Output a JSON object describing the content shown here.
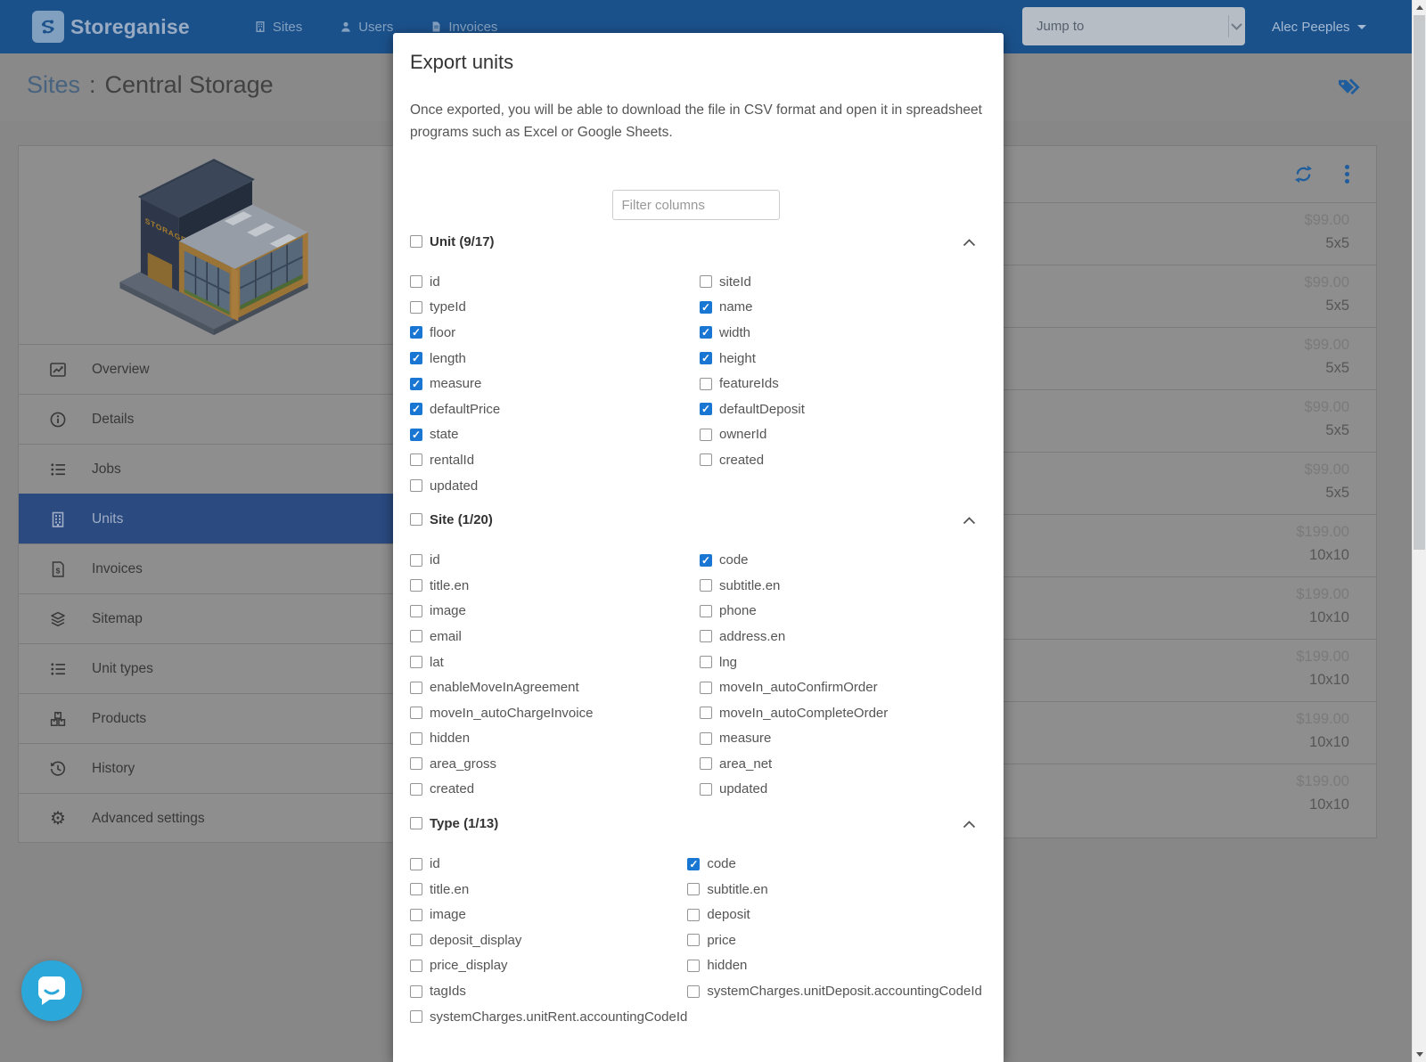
{
  "navbar": {
    "logo_text": "Storeganise",
    "items": [
      {
        "label": "Sites",
        "icon": "building-sm-icon"
      },
      {
        "label": "Users",
        "icon": "user-sm-icon"
      },
      {
        "label": "Invoices",
        "icon": "invoice-sm-icon"
      }
    ],
    "jump_to_placeholder": "Jump to",
    "user_name": "Alec Peeples"
  },
  "title_bar": {
    "breadcrumb": "Sites",
    "separator": ":",
    "title": "Central Storage"
  },
  "sidebar": {
    "items": [
      {
        "label": "Overview",
        "icon": "chart-line-icon"
      },
      {
        "label": "Details",
        "icon": "info-icon"
      },
      {
        "label": "Jobs",
        "icon": "list-icon"
      },
      {
        "label": "Units",
        "icon": "building-icon",
        "selected": true
      },
      {
        "label": "Invoices",
        "icon": "invoice-icon"
      },
      {
        "label": "Sitemap",
        "icon": "layers-icon"
      },
      {
        "label": "Unit types",
        "icon": "list-icon"
      },
      {
        "label": "Products",
        "icon": "products-icon"
      },
      {
        "label": "History",
        "icon": "history-icon"
      },
      {
        "label": "Advanced settings",
        "icon": "gear-icon"
      }
    ]
  },
  "units_table": {
    "rows": [
      {
        "price": "$99.00",
        "size": "5x5"
      },
      {
        "price": "$99.00",
        "size": "5x5"
      },
      {
        "price": "$99.00",
        "size": "5x5"
      },
      {
        "price": "$99.00",
        "size": "5x5"
      },
      {
        "price": "$99.00",
        "size": "5x5"
      },
      {
        "price": "$199.00",
        "size": "10x10"
      },
      {
        "price": "$199.00",
        "size": "10x10"
      },
      {
        "price": "$199.00",
        "size": "10x10"
      },
      {
        "price": "$199.00",
        "size": "10x10"
      },
      {
        "price": "$199.00",
        "size": "10x10"
      }
    ]
  },
  "modal": {
    "title": "Export units",
    "description": "Once exported, you will be able to download the file in CSV format and open it in spreadsheet programs such as Excel or Google Sheets.",
    "filter_placeholder": "Filter columns",
    "sections": [
      {
        "label": "Unit",
        "count": "(9/17)",
        "left": [
          {
            "label": "id",
            "checked": false
          },
          {
            "label": "typeId",
            "checked": false
          },
          {
            "label": "floor",
            "checked": true
          },
          {
            "label": "length",
            "checked": true
          },
          {
            "label": "measure",
            "checked": true
          },
          {
            "label": "defaultPrice",
            "checked": true
          },
          {
            "label": "state",
            "checked": true
          },
          {
            "label": "rentalId",
            "checked": false
          },
          {
            "label": "updated",
            "checked": false
          }
        ],
        "right": [
          {
            "label": "siteId",
            "checked": false
          },
          {
            "label": "name",
            "checked": true
          },
          {
            "label": "width",
            "checked": true
          },
          {
            "label": "height",
            "checked": true
          },
          {
            "label": "featureIds",
            "checked": false
          },
          {
            "label": "defaultDeposit",
            "checked": true
          },
          {
            "label": "ownerId",
            "checked": false
          },
          {
            "label": "created",
            "checked": false
          }
        ]
      },
      {
        "label": "Site",
        "count": "(1/20)",
        "left": [
          {
            "label": "id",
            "checked": false
          },
          {
            "label": "title.en",
            "checked": false
          },
          {
            "label": "image",
            "checked": false
          },
          {
            "label": "email",
            "checked": false
          },
          {
            "label": "lat",
            "checked": false
          },
          {
            "label": "enableMoveInAgreement",
            "checked": false
          },
          {
            "label": "moveIn_autoChargeInvoice",
            "checked": false
          },
          {
            "label": "hidden",
            "checked": false
          },
          {
            "label": "area_gross",
            "checked": false
          },
          {
            "label": "created",
            "checked": false
          }
        ],
        "right": [
          {
            "label": "code",
            "checked": true
          },
          {
            "label": "subtitle.en",
            "checked": false
          },
          {
            "label": "phone",
            "checked": false
          },
          {
            "label": "address.en",
            "checked": false
          },
          {
            "label": "lng",
            "checked": false
          },
          {
            "label": "moveIn_autoConfirmOrder",
            "checked": false
          },
          {
            "label": "moveIn_autoCompleteOrder",
            "checked": false
          },
          {
            "label": "measure",
            "checked": false
          },
          {
            "label": "area_net",
            "checked": false
          },
          {
            "label": "updated",
            "checked": false
          }
        ]
      },
      {
        "label": "Type",
        "count": "(1/13)",
        "left": [
          {
            "label": "id",
            "checked": false
          },
          {
            "label": "title.en",
            "checked": false
          },
          {
            "label": "image",
            "checked": false
          },
          {
            "label": "deposit_display",
            "checked": false
          },
          {
            "label": "price_display",
            "checked": false
          },
          {
            "label": "tagIds",
            "checked": false
          },
          {
            "label": "systemCharges.unitRent.accountingCodeId",
            "checked": false
          }
        ],
        "right": [
          {
            "label": "code",
            "checked": true
          },
          {
            "label": "subtitle.en",
            "checked": false
          },
          {
            "label": "deposit",
            "checked": false
          },
          {
            "label": "price",
            "checked": false
          },
          {
            "label": "hidden",
            "checked": false
          },
          {
            "label": "systemCharges.unitDeposit.accountingCodeId",
            "checked": false
          }
        ]
      }
    ]
  },
  "colors": {
    "navbar": "#1b518b",
    "accent_checkbox": "#1976d2",
    "selected_sidebar_item": "#2a4a80",
    "action_icon_blue": "#1f5d9c",
    "chat_button": "#2ca7d9"
  }
}
